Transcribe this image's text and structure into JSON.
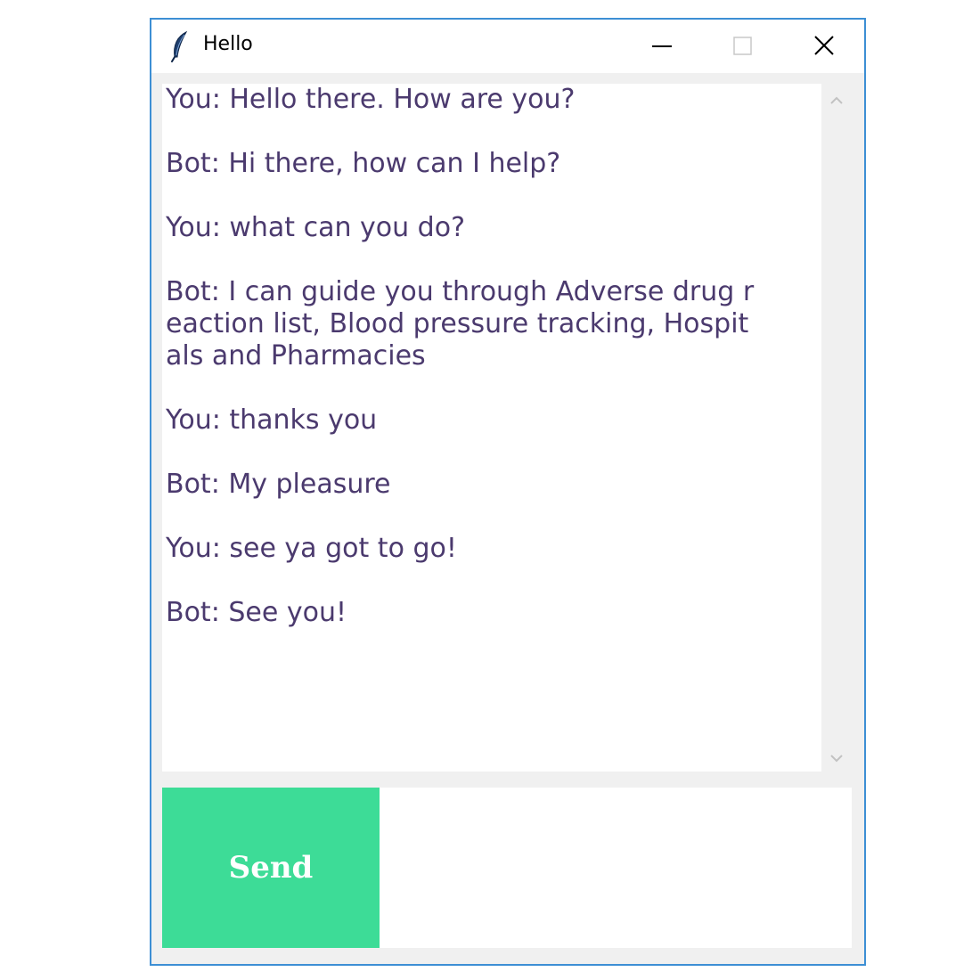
{
  "window": {
    "title": "Hello",
    "border_color": "#3d8fd4"
  },
  "icons": {
    "app": "feather-icon",
    "minimize": "minimize-icon",
    "maximize": "maximize-icon",
    "close": "close-icon",
    "scroll_up": "chevron-up-icon",
    "scroll_down": "chevron-down-icon"
  },
  "chat": {
    "text_color": "#4b3a6e",
    "messages": [
      {
        "lines": [
          "You: Hello there. How are you?"
        ]
      },
      {
        "lines": [
          "Bot: Hi there, how can I help?"
        ]
      },
      {
        "lines": [
          "You: what can you do?"
        ]
      },
      {
        "lines": [
          "Bot: I can guide you through Adverse drug r",
          "eaction list, Blood pressure tracking, Hospit",
          "als and Pharmacies"
        ]
      },
      {
        "lines": [
          "You: thanks you"
        ]
      },
      {
        "lines": [
          "Bot: My pleasure"
        ]
      },
      {
        "lines": [
          "You: see ya got to go!"
        ]
      },
      {
        "lines": [
          "Bot: See you!"
        ]
      }
    ]
  },
  "input": {
    "send_label": "Send",
    "send_color": "#3ddc97",
    "entry_value": ""
  }
}
